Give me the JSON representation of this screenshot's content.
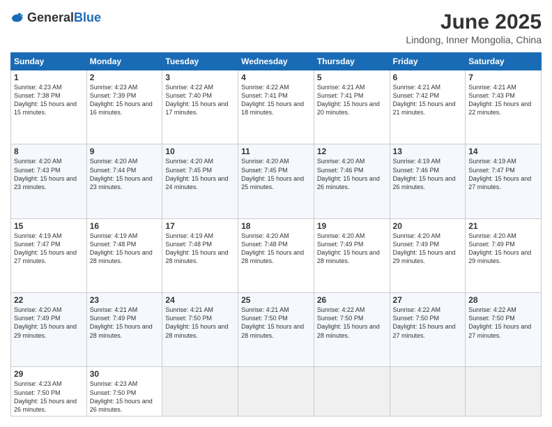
{
  "header": {
    "logo_general": "General",
    "logo_blue": "Blue",
    "month_title": "June 2025",
    "location": "Lindong, Inner Mongolia, China"
  },
  "days_of_week": [
    "Sunday",
    "Monday",
    "Tuesday",
    "Wednesday",
    "Thursday",
    "Friday",
    "Saturday"
  ],
  "weeks": [
    [
      {
        "day": "1",
        "sunrise": "4:23 AM",
        "sunset": "7:38 PM",
        "daylight": "15 hours and 15 minutes."
      },
      {
        "day": "2",
        "sunrise": "4:23 AM",
        "sunset": "7:39 PM",
        "daylight": "15 hours and 16 minutes."
      },
      {
        "day": "3",
        "sunrise": "4:22 AM",
        "sunset": "7:40 PM",
        "daylight": "15 hours and 17 minutes."
      },
      {
        "day": "4",
        "sunrise": "4:22 AM",
        "sunset": "7:41 PM",
        "daylight": "15 hours and 18 minutes."
      },
      {
        "day": "5",
        "sunrise": "4:21 AM",
        "sunset": "7:41 PM",
        "daylight": "15 hours and 20 minutes."
      },
      {
        "day": "6",
        "sunrise": "4:21 AM",
        "sunset": "7:42 PM",
        "daylight": "15 hours and 21 minutes."
      },
      {
        "day": "7",
        "sunrise": "4:21 AM",
        "sunset": "7:43 PM",
        "daylight": "15 hours and 22 minutes."
      }
    ],
    [
      {
        "day": "8",
        "sunrise": "4:20 AM",
        "sunset": "7:43 PM",
        "daylight": "15 hours and 23 minutes."
      },
      {
        "day": "9",
        "sunrise": "4:20 AM",
        "sunset": "7:44 PM",
        "daylight": "15 hours and 23 minutes."
      },
      {
        "day": "10",
        "sunrise": "4:20 AM",
        "sunset": "7:45 PM",
        "daylight": "15 hours and 24 minutes."
      },
      {
        "day": "11",
        "sunrise": "4:20 AM",
        "sunset": "7:45 PM",
        "daylight": "15 hours and 25 minutes."
      },
      {
        "day": "12",
        "sunrise": "4:20 AM",
        "sunset": "7:46 PM",
        "daylight": "15 hours and 26 minutes."
      },
      {
        "day": "13",
        "sunrise": "4:19 AM",
        "sunset": "7:46 PM",
        "daylight": "15 hours and 26 minutes."
      },
      {
        "day": "14",
        "sunrise": "4:19 AM",
        "sunset": "7:47 PM",
        "daylight": "15 hours and 27 minutes."
      }
    ],
    [
      {
        "day": "15",
        "sunrise": "4:19 AM",
        "sunset": "7:47 PM",
        "daylight": "15 hours and 27 minutes."
      },
      {
        "day": "16",
        "sunrise": "4:19 AM",
        "sunset": "7:48 PM",
        "daylight": "15 hours and 28 minutes."
      },
      {
        "day": "17",
        "sunrise": "4:19 AM",
        "sunset": "7:48 PM",
        "daylight": "15 hours and 28 minutes."
      },
      {
        "day": "18",
        "sunrise": "4:20 AM",
        "sunset": "7:48 PM",
        "daylight": "15 hours and 28 minutes."
      },
      {
        "day": "19",
        "sunrise": "4:20 AM",
        "sunset": "7:49 PM",
        "daylight": "15 hours and 28 minutes."
      },
      {
        "day": "20",
        "sunrise": "4:20 AM",
        "sunset": "7:49 PM",
        "daylight": "15 hours and 29 minutes."
      },
      {
        "day": "21",
        "sunrise": "4:20 AM",
        "sunset": "7:49 PM",
        "daylight": "15 hours and 29 minutes."
      }
    ],
    [
      {
        "day": "22",
        "sunrise": "4:20 AM",
        "sunset": "7:49 PM",
        "daylight": "15 hours and 29 minutes."
      },
      {
        "day": "23",
        "sunrise": "4:21 AM",
        "sunset": "7:49 PM",
        "daylight": "15 hours and 28 minutes."
      },
      {
        "day": "24",
        "sunrise": "4:21 AM",
        "sunset": "7:50 PM",
        "daylight": "15 hours and 28 minutes."
      },
      {
        "day": "25",
        "sunrise": "4:21 AM",
        "sunset": "7:50 PM",
        "daylight": "15 hours and 28 minutes."
      },
      {
        "day": "26",
        "sunrise": "4:22 AM",
        "sunset": "7:50 PM",
        "daylight": "15 hours and 28 minutes."
      },
      {
        "day": "27",
        "sunrise": "4:22 AM",
        "sunset": "7:50 PM",
        "daylight": "15 hours and 27 minutes."
      },
      {
        "day": "28",
        "sunrise": "4:22 AM",
        "sunset": "7:50 PM",
        "daylight": "15 hours and 27 minutes."
      }
    ],
    [
      {
        "day": "29",
        "sunrise": "4:23 AM",
        "sunset": "7:50 PM",
        "daylight": "15 hours and 26 minutes."
      },
      {
        "day": "30",
        "sunrise": "4:23 AM",
        "sunset": "7:50 PM",
        "daylight": "15 hours and 26 minutes."
      },
      null,
      null,
      null,
      null,
      null
    ]
  ]
}
